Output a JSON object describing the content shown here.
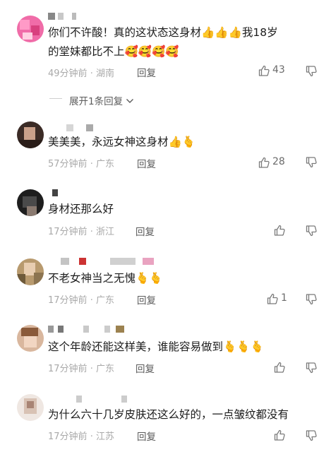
{
  "comments": [
    {
      "text": "你们不许酸！真的这状态这身材👍👍👍我18岁",
      "text_line2": "的堂妹都比不上🥰🥰🥰🥰",
      "time": "49分钟前",
      "location": "湖南",
      "reply_label": "回复",
      "likes": "43"
    },
    {
      "text": "美美美，永远女神这身材👍🫰",
      "time": "57分钟前",
      "location": "广东",
      "reply_label": "回复",
      "likes": "28"
    },
    {
      "text": "身材还那么好",
      "time": "17分钟前",
      "location": "浙江",
      "reply_label": "回复",
      "likes": ""
    },
    {
      "text": "不老女神当之无愧🫰🫰",
      "time": "17分钟前",
      "location": "广东",
      "reply_label": "回复",
      "likes": "1"
    },
    {
      "text": "这个年龄还能这样美，谁能容易做到🫰🫰🫰",
      "time": "17分钟前",
      "location": "广东",
      "reply_label": "回复",
      "likes": ""
    },
    {
      "text": "为什么六十几岁皮肤还这么好的，一点皱纹都没有",
      "time": "17分钟前",
      "location": "江苏",
      "reply_label": "回复",
      "likes": ""
    }
  ],
  "expand_replies": "展开1条回复",
  "colors": {
    "meta": "#a9a9a9",
    "icon": "#7a7a7a"
  }
}
